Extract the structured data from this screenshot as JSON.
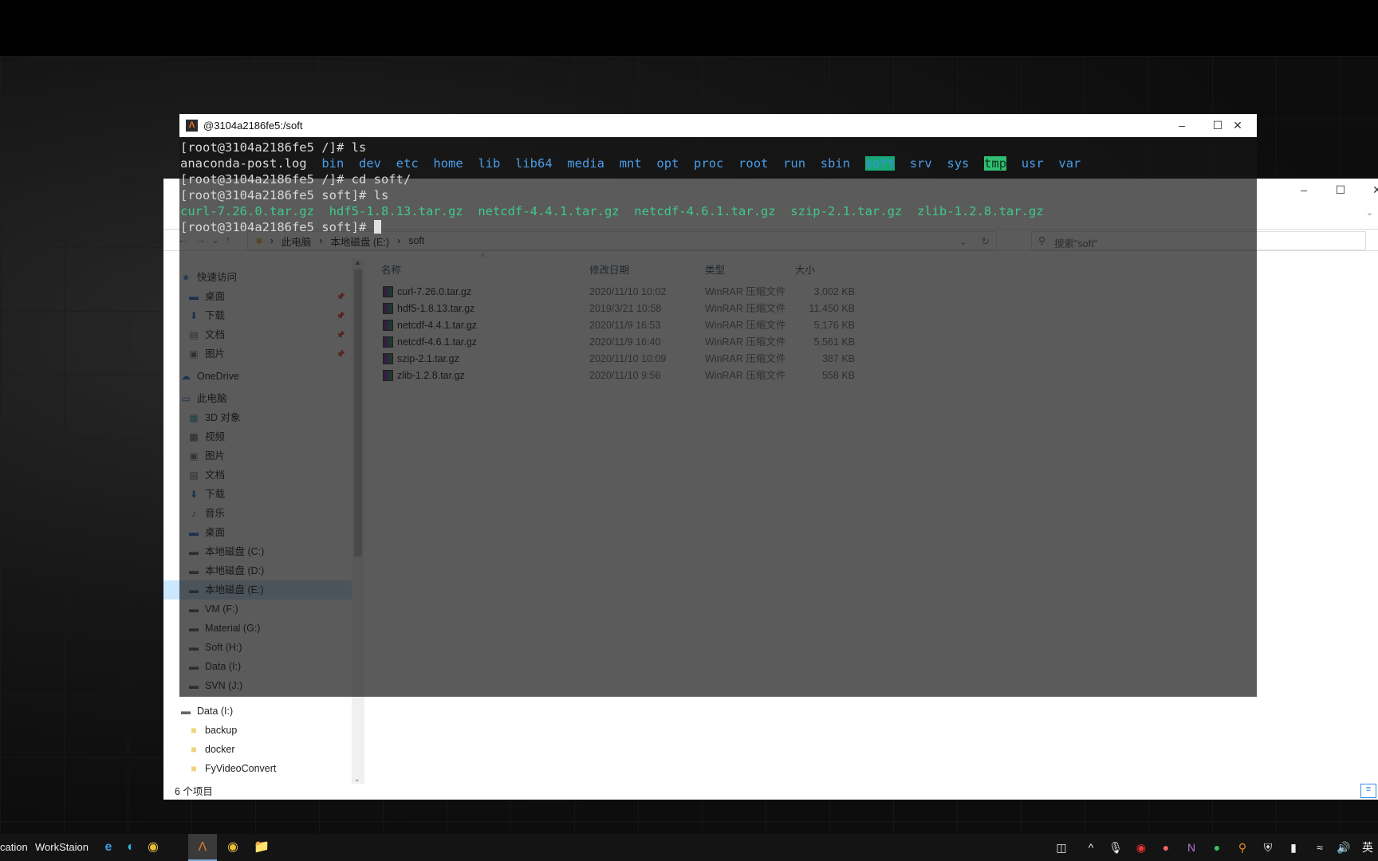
{
  "terminal": {
    "title": "@3104a2186fe5:/soft",
    "lines": {
      "l1": "[root@3104a2186fe5 /]# ls",
      "l2_file": "anaconda-post.log",
      "dirs": [
        "bin",
        "dev",
        "etc",
        "home",
        "lib",
        "lib64",
        "media",
        "mnt",
        "opt",
        "proc",
        "root",
        "run",
        "sbin",
        "soft",
        "srv",
        "sys",
        "tmp",
        "usr",
        "var"
      ],
      "l3": "[root@3104a2186fe5 /]# cd soft/",
      "l4": "[root@3104a2186fe5 soft]# ls",
      "archives": [
        "curl-7.26.0.tar.gz",
        "hdf5-1.8.13.tar.gz",
        "netcdf-4.4.1.tar.gz",
        "netcdf-4.6.1.tar.gz",
        "szip-2.1.tar.gz",
        "zlib-1.2.8.tar.gz"
      ],
      "l6": "[root@3104a2186fe5 soft]# "
    },
    "colors": {
      "dir": "#4a9de8",
      "archive": "#3fc88c",
      "soft_bg": "#18a878",
      "tmp_bg": "#2fbf71"
    }
  },
  "explorer": {
    "breadcrumb": [
      "此电脑",
      "本地磁盘 (E:)",
      "soft"
    ],
    "search_placeholder": "搜索\"soft\"",
    "columns": [
      "名称",
      "修改日期",
      "类型",
      "大小"
    ],
    "files": [
      {
        "name": "curl-7.26.0.tar.gz",
        "date": "2020/11/10 10:02",
        "type": "WinRAR 压缩文件",
        "size": "3,002 KB"
      },
      {
        "name": "hdf5-1.8.13.tar.gz",
        "date": "2019/3/21 10:58",
        "type": "WinRAR 压缩文件",
        "size": "11,450 KB"
      },
      {
        "name": "netcdf-4.4.1.tar.gz",
        "date": "2020/11/9 16:53",
        "type": "WinRAR 压缩文件",
        "size": "5,176 KB"
      },
      {
        "name": "netcdf-4.6.1.tar.gz",
        "date": "2020/11/9 16:40",
        "type": "WinRAR 压缩文件",
        "size": "5,561 KB"
      },
      {
        "name": "szip-2.1.tar.gz",
        "date": "2020/11/10 10:09",
        "type": "WinRAR 压缩文件",
        "size": "387 KB"
      },
      {
        "name": "zlib-1.2.8.tar.gz",
        "date": "2020/11/10 9:56",
        "type": "WinRAR 压缩文件",
        "size": "558 KB"
      }
    ],
    "sidebar": [
      {
        "label": "快速访问",
        "icon": "star-icon",
        "indent": 0
      },
      {
        "label": "桌面",
        "icon": "desktop-icon",
        "indent": 1
      },
      {
        "label": "下载",
        "icon": "download-icon",
        "indent": 1
      },
      {
        "label": "文档",
        "icon": "document-icon",
        "indent": 1
      },
      {
        "label": "图片",
        "icon": "picture-icon",
        "indent": 1
      },
      {
        "label": "OneDrive",
        "icon": "cloud-icon",
        "indent": 0
      },
      {
        "label": "此电脑",
        "icon": "computer-icon",
        "indent": 0
      },
      {
        "label": "3D 对象",
        "icon": "cube-icon",
        "indent": 1
      },
      {
        "label": "视频",
        "icon": "video-icon",
        "indent": 1
      },
      {
        "label": "图片",
        "icon": "picture-icon",
        "indent": 1
      },
      {
        "label": "文档",
        "icon": "document-icon",
        "indent": 1
      },
      {
        "label": "下载",
        "icon": "download-icon",
        "indent": 1
      },
      {
        "label": "音乐",
        "icon": "music-icon",
        "indent": 1
      },
      {
        "label": "桌面",
        "icon": "desktop-icon",
        "indent": 1
      },
      {
        "label": "本地磁盘 (C:)",
        "icon": "drive-icon",
        "indent": 1
      },
      {
        "label": "本地磁盘 (D:)",
        "icon": "drive-icon",
        "indent": 1
      },
      {
        "label": "本地磁盘 (E:)",
        "icon": "drive-icon",
        "indent": 1,
        "selected": true
      },
      {
        "label": "VM (F:)",
        "icon": "drive-icon",
        "indent": 1
      },
      {
        "label": "Material (G:)",
        "icon": "drive-icon",
        "indent": 1
      },
      {
        "label": "Soft (H:)",
        "icon": "drive-icon",
        "indent": 1
      },
      {
        "label": "Data (I:)",
        "icon": "drive-icon",
        "indent": 1
      },
      {
        "label": "SVN (J:)",
        "icon": "drive-icon",
        "indent": 1
      },
      {
        "label": "Data (I:)",
        "icon": "drive-icon",
        "indent": 0
      },
      {
        "label": "backup",
        "icon": "folder-icon",
        "indent": 1
      },
      {
        "label": "docker",
        "icon": "folder-icon",
        "indent": 1
      },
      {
        "label": "FyVideoConvert",
        "icon": "folder-icon",
        "indent": 1
      }
    ],
    "status": "6 个项目"
  },
  "taskbar": {
    "labels": [
      "cation",
      "WorkStaion"
    ],
    "tray_ime": "英"
  }
}
